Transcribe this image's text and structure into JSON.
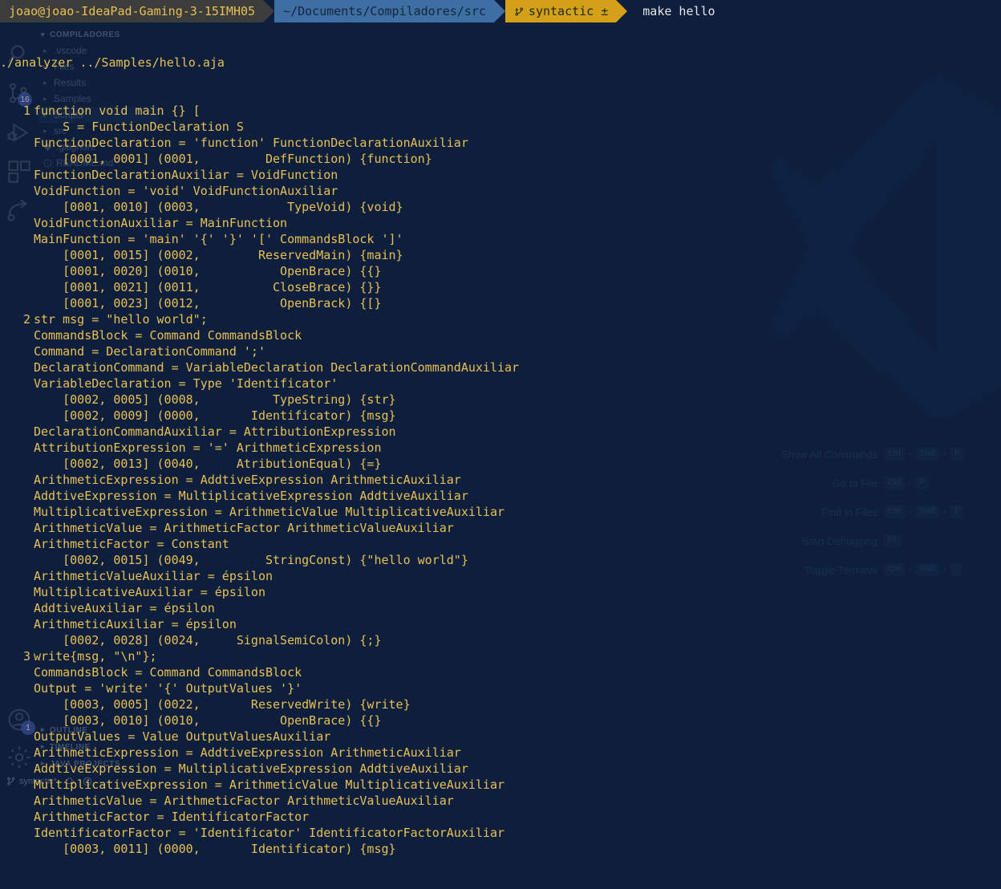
{
  "prompt": {
    "user": "joao@joao-IdeaPad-Gaming-3-15IMH05",
    "path": "~/Documents/Compiladores/src",
    "git_branch": "syntactic ±",
    "git_icon": "git-branch-icon",
    "command": "make hello"
  },
  "terminal": {
    "command_echo": "./analyzer ../Samples/hello.aja",
    "lines": [
      {
        "num": "1",
        "text": "function void main {} ["
      },
      {
        "num": "",
        "text": "    S = FunctionDeclaration S"
      },
      {
        "num": "",
        "text": "FunctionDeclaration = 'function' FunctionDeclarationAuxiliar"
      },
      {
        "num": "",
        "text": "    [0001, 0001] (0001,         DefFunction) {function}"
      },
      {
        "num": "",
        "text": "FunctionDeclarationAuxiliar = VoidFunction"
      },
      {
        "num": "",
        "text": "VoidFunction = 'void' VoidFunctionAuxiliar"
      },
      {
        "num": "",
        "text": "    [0001, 0010] (0003,            TypeVoid) {void}"
      },
      {
        "num": "",
        "text": "VoidFunctionAuxiliar = MainFunction"
      },
      {
        "num": "",
        "text": "MainFunction = 'main' '{' '}' '[' CommandsBlock ']'"
      },
      {
        "num": "",
        "text": "    [0001, 0015] (0002,        ReservedMain) {main}"
      },
      {
        "num": "",
        "text": "    [0001, 0020] (0010,           OpenBrace) {{}"
      },
      {
        "num": "",
        "text": "    [0001, 0021] (0011,          CloseBrace) {}}"
      },
      {
        "num": "",
        "text": "    [0001, 0023] (0012,           OpenBrack) {[}"
      },
      {
        "num": "2",
        "text": "str msg = \"hello world\";"
      },
      {
        "num": "",
        "text": "CommandsBlock = Command CommandsBlock"
      },
      {
        "num": "",
        "text": "Command = DeclarationCommand ';'"
      },
      {
        "num": "",
        "text": "DeclarationCommand = VariableDeclaration DeclarationCommandAuxiliar"
      },
      {
        "num": "",
        "text": "VariableDeclaration = Type 'Identificator'"
      },
      {
        "num": "",
        "text": "    [0002, 0005] (0008,          TypeString) {str}"
      },
      {
        "num": "",
        "text": "    [0002, 0009] (0000,       Identificator) {msg}"
      },
      {
        "num": "",
        "text": "DeclarationCommandAuxiliar = AttributionExpression"
      },
      {
        "num": "",
        "text": "AttributionExpression = '=' ArithmeticExpression"
      },
      {
        "num": "",
        "text": "    [0002, 0013] (0040,     AtributionEqual) {=}"
      },
      {
        "num": "",
        "text": "ArithmeticExpression = AddtiveExpression ArithmeticAuxiliar"
      },
      {
        "num": "",
        "text": "AddtiveExpression = MultiplicativeExpression AddtiveAuxiliar"
      },
      {
        "num": "",
        "text": "MultiplicativeExpression = ArithmeticValue MultiplicativeAuxiliar"
      },
      {
        "num": "",
        "text": "ArithmeticValue = ArithmeticFactor ArithmeticValueAuxiliar"
      },
      {
        "num": "",
        "text": "ArithmeticFactor = Constant"
      },
      {
        "num": "",
        "text": "    [0002, 0015] (0049,         StringConst) {\"hello world\"}"
      },
      {
        "num": "",
        "text": "ArithmeticValueAuxiliar = épsilon"
      },
      {
        "num": "",
        "text": "MultiplicativeAuxiliar = épsilon"
      },
      {
        "num": "",
        "text": "AddtiveAuxiliar = épsilon"
      },
      {
        "num": "",
        "text": "ArithmeticAuxiliar = épsilon"
      },
      {
        "num": "",
        "text": "    [0002, 0028] (0024,     SignalSemiColon) {;}"
      },
      {
        "num": "3",
        "text": "write{msg, \"\\n\"};"
      },
      {
        "num": "",
        "text": "CommandsBlock = Command CommandsBlock"
      },
      {
        "num": "",
        "text": "Output = 'write' '{' OutputValues '}'"
      },
      {
        "num": "",
        "text": "    [0003, 0005] (0022,       ReservedWrite) {write}"
      },
      {
        "num": "",
        "text": "    [0003, 0010] (0010,           OpenBrace) {{}"
      },
      {
        "num": "",
        "text": "OutputValues = Value OutputValuesAuxiliar"
      },
      {
        "num": "",
        "text": "ArithmeticExpression = AddtiveExpression ArithmeticAuxiliar"
      },
      {
        "num": "",
        "text": "AddtiveExpression = MultiplicativeExpression AddtiveAuxiliar"
      },
      {
        "num": "",
        "text": "MultiplicativeExpression = ArithmeticValue MultiplicativeAuxiliar"
      },
      {
        "num": "",
        "text": "ArithmeticValue = ArithmeticFactor ArithmeticValueAuxiliar"
      },
      {
        "num": "",
        "text": "ArithmeticFactor = IdentificatorFactor"
      },
      {
        "num": "",
        "text": "IdentificatorFactor = 'Identificator' IdentificatorFactorAuxiliar"
      },
      {
        "num": "",
        "text": "    [0003, 0011] (0000,       Identificator) {msg}"
      }
    ]
  },
  "activitybar": {
    "items": [
      {
        "name": "search-icon",
        "badge": ""
      },
      {
        "name": "source-control-icon",
        "badge": "16"
      },
      {
        "name": "run-and-debug-icon",
        "badge": ""
      },
      {
        "name": "extensions-icon",
        "badge": ""
      },
      {
        "name": "remote-explorer-icon",
        "badge": ""
      }
    ],
    "account_badge": "1"
  },
  "explorer": {
    "title": "COMPILADORES",
    "items": [
      {
        "label": ".vscode",
        "type": "folder"
      },
      {
        "label": "Files",
        "type": "folder"
      },
      {
        "label": "Results",
        "type": "folder"
      },
      {
        "label": "Samples",
        "type": "folder"
      },
      {
        "label": "Scripts",
        "type": "folder"
      },
      {
        "label": "src",
        "type": "folder"
      },
      {
        "label": ".gitignore",
        "type": "file-git"
      },
      {
        "label": "README.md",
        "type": "file-info"
      }
    ],
    "sections": [
      {
        "label": "OUTLINE"
      },
      {
        "label": "TIMELINE"
      },
      {
        "label": "JAVA PROJECTS"
      }
    ]
  },
  "statusbar": {
    "branch": "syntactic*",
    "sync_icon": "cloud-sync-icon",
    "problems_icon": "error-circle-icon"
  },
  "welcome": {
    "shortcuts": [
      {
        "label": "Show All Commands",
        "keys": [
          "Ctrl",
          "Shift",
          "P"
        ]
      },
      {
        "label": "Go to File",
        "keys": [
          "Ctrl",
          "P"
        ]
      },
      {
        "label": "Find in Files",
        "keys": [
          "Ctrl",
          "Shift",
          "F"
        ]
      },
      {
        "label": "Start Debugging",
        "keys": [
          "F5"
        ]
      },
      {
        "label": "Toggle Terminal",
        "keys": [
          "Ctrl",
          "Shift",
          "`"
        ]
      }
    ]
  },
  "colors": {
    "background": "#0d1f3c",
    "terminal_text": "#e8c055",
    "prompt_user_bg": "#3c3c3c",
    "prompt_path_bg": "#3d6fa5",
    "prompt_git_bg": "#d3a017",
    "command_text": "#e6e6e6"
  }
}
